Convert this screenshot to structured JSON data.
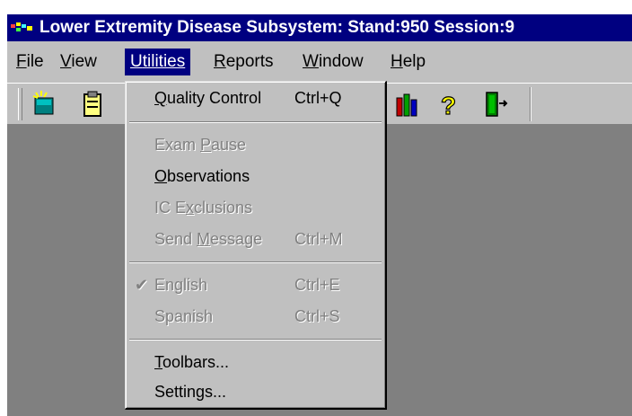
{
  "window": {
    "title": "Lower Extremity Disease Subsystem: Stand:950 Session:9"
  },
  "menubar": {
    "items": [
      {
        "pre": "",
        "u": "F",
        "post": "ile"
      },
      {
        "pre": "",
        "u": "V",
        "post": "iew"
      },
      {
        "pre": "",
        "u": "U",
        "post": "tilities"
      },
      {
        "pre": "",
        "u": "R",
        "post": "eports"
      },
      {
        "pre": "",
        "u": "W",
        "post": "indow"
      },
      {
        "pre": "",
        "u": "H",
        "post": "elp"
      }
    ],
    "active": "Utilities"
  },
  "toolbar": {
    "buttons": [
      "new-record-icon",
      "clipboard-icon",
      "chart-icon",
      "help-icon",
      "exit-icon"
    ]
  },
  "utilities_menu": {
    "quality_control": {
      "pre": "",
      "u": "Q",
      "post": "uality Control",
      "shortcut": "Ctrl+Q",
      "enabled": true
    },
    "exam_pause": {
      "pre": "Exam ",
      "u": "P",
      "post": "ause",
      "shortcut": "",
      "enabled": false
    },
    "observations": {
      "pre": "",
      "u": "O",
      "post": "bservations",
      "shortcut": "",
      "enabled": true
    },
    "ic_exclusions": {
      "pre": "IC E",
      "u": "x",
      "post": "clusions",
      "shortcut": "",
      "enabled": false
    },
    "send_message": {
      "pre": "Send ",
      "u": "M",
      "post": "essage",
      "shortcut": "Ctrl+M",
      "enabled": false
    },
    "english": {
      "pre": "English",
      "u": "",
      "post": "",
      "shortcut": "Ctrl+E",
      "enabled": false,
      "checked": true
    },
    "spanish": {
      "pre": "Spanish",
      "u": "",
      "post": "",
      "shortcut": "Ctrl+S",
      "enabled": false
    },
    "toolbars": {
      "pre": "",
      "u": "T",
      "post": "oolbars...",
      "shortcut": "",
      "enabled": true
    },
    "settings": {
      "pre": "Settings...",
      "u": "",
      "post": "",
      "shortcut": "",
      "enabled": true
    }
  },
  "colors": {
    "title_bar": "#000080",
    "face": "#c0c0c0",
    "workspace": "#808080"
  }
}
